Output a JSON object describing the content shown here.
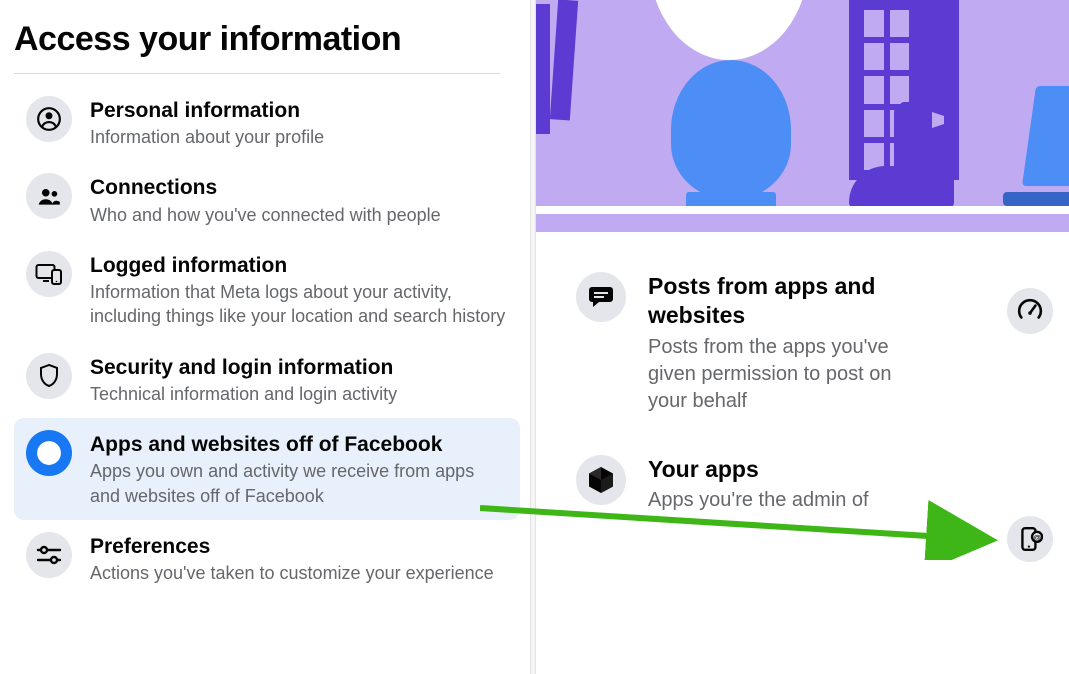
{
  "sidebar": {
    "heading": "Access your information",
    "items": [
      {
        "title": "Personal information",
        "desc": "Information about your profile"
      },
      {
        "title": "Connections",
        "desc": "Who and how you've connected with people"
      },
      {
        "title": "Logged information",
        "desc": "Information that Meta logs about your activity, including things like your location and search history"
      },
      {
        "title": "Security and login information",
        "desc": "Technical information and login activity"
      },
      {
        "title": "Apps and websites off of Facebook",
        "desc": "Apps you own and activity we receive from apps and websites off of Facebook"
      },
      {
        "title": "Preferences",
        "desc": "Actions you've taken to customize your experience"
      }
    ],
    "selected_index": 4
  },
  "content": {
    "cards": [
      {
        "title": "Posts from apps and websites",
        "desc": "Posts from the apps you've given permission to post on your behalf"
      },
      {
        "title": "Your apps",
        "desc": "Apps you're the admin of"
      }
    ]
  }
}
